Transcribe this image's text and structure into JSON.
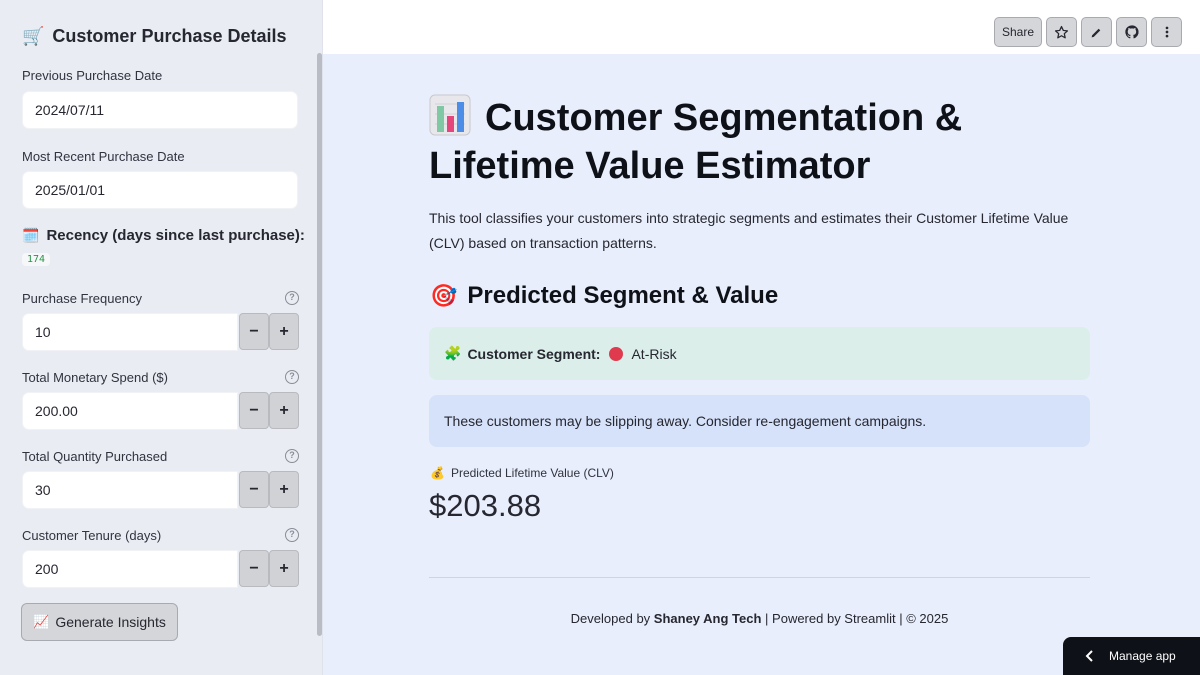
{
  "sidebar": {
    "title": "Customer Purchase Details",
    "prev_date_label": "Previous Purchase Date",
    "prev_date_value": "2024/07/11",
    "recent_date_label": "Most Recent Purchase Date",
    "recent_date_value": "2025/01/01",
    "recency_label": "Recency (days since last purchase):",
    "recency_value": "174",
    "frequency_label": "Purchase Frequency",
    "frequency_value": "10",
    "monetary_label": "Total Monetary Spend ($)",
    "monetary_value": "200.00",
    "quantity_label": "Total Quantity Purchased",
    "quantity_value": "30",
    "tenure_label": "Customer Tenure (days)",
    "tenure_value": "200",
    "minus": "−",
    "plus": "+",
    "help": "?",
    "generate_label": "Generate Insights"
  },
  "header": {
    "share_label": "Share"
  },
  "main": {
    "title": "Customer Segmentation & Lifetime Value Estimator",
    "description": "This tool classifies your customers into strategic segments and estimates their Customer Lifetime Value (CLV) based on transaction patterns.",
    "section_title": "Predicted Segment & Value",
    "segment_label": "Customer Segment:",
    "segment_value": "At-Risk",
    "info_text": "These customers may be slipping away. Consider re-engagement campaigns.",
    "clv_label": "Predicted Lifetime Value (CLV)",
    "clv_value": "$203.88"
  },
  "footer": {
    "prefix": "Developed by ",
    "author": "Shaney Ang Tech",
    "suffix": " | Powered by Streamlit | © 2025"
  },
  "manage_app_label": "Manage app",
  "icons": {
    "sidebar_title": "cart-icon",
    "recency": "calendar-icon",
    "generate": "chart-up-icon",
    "main_title": "bar-chart-icon",
    "section": "target-icon",
    "segment": "puzzle-icon",
    "segment_status": "red-circle-icon",
    "clv": "money-bag-icon"
  },
  "colors": {
    "success_bg": "#dbeeea",
    "info_bg": "#d6e2fa",
    "status_red": "#e03a4e"
  }
}
